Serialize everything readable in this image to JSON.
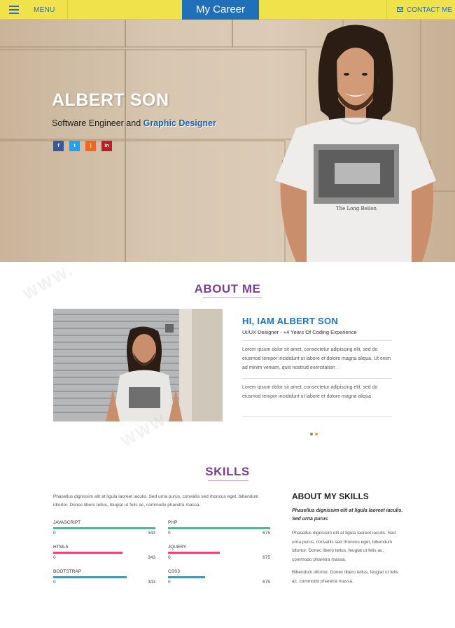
{
  "nav": {
    "menu_label": "MENU",
    "brand": "My Career",
    "contact_label": "CONTACT ME"
  },
  "hero": {
    "name": "ALBERT SON",
    "role_prefix": "Software Engineer and ",
    "role_highlight": "Graphic Designer",
    "tshirt_caption": "The Long Bellon",
    "socials": [
      {
        "icon": "facebook-icon",
        "glyph": "f",
        "color": "#3b5998"
      },
      {
        "icon": "twitter-icon",
        "glyph": "t",
        "color": "#1da1f2"
      },
      {
        "icon": "rss-icon",
        "glyph": ")",
        "color": "#f26522"
      },
      {
        "icon": "linkedin-icon",
        "glyph": "in",
        "color": "#c4172b"
      }
    ]
  },
  "about": {
    "title": "ABOUT ME",
    "heading": "HI, IAM ALBERT SON",
    "subtitle": "UI/UX Designer - +4 Years Of Coding Experience",
    "p1": "Lorem ipsum dolor sit amet, consectetur adipiscing elit, sed do eiusmod tempor incididunt ut labore et dolore magna aliqua. Ut enim ad minim veniam, quis nostrud exercitation .",
    "p2": "Lorem ipsum dolor sit amet, consectetur adipiscing elit, sed do eiusmod tempor incididunt ut labore et dolore magna aliqua.",
    "dot_colors": [
      "#888888",
      "#f0a030"
    ]
  },
  "skills": {
    "title": "SKILLS",
    "intro": "Phasellus dignissim elit at ligula laoreet iaculis. Sed urna purus, convallis sed rhoncus eget, bibendum idtortor. Donec libero tellus, feugiat ut felis ac, commodo pharetra massa.",
    "items": [
      {
        "name": "JAVASCRIPT",
        "min": "0",
        "max": "343",
        "level": 1.0,
        "color": "#2ec4a0"
      },
      {
        "name": "PHP",
        "min": "0",
        "max": "675",
        "level": 1.0,
        "color": "#2ec4a0"
      },
      {
        "name": "HTML5",
        "min": "0",
        "max": "343",
        "level": 0.68,
        "color": "#e8457a"
      },
      {
        "name": "JQUERY",
        "min": "0",
        "max": "675",
        "level": 0.51,
        "color": "#e8457a"
      },
      {
        "name": "BOOTSTRAP",
        "min": "0",
        "max": "343",
        "level": 0.72,
        "color": "#1aa5d8"
      },
      {
        "name": "CSS3",
        "min": "0",
        "max": "675",
        "level": 0.36,
        "color": "#1aa5d8"
      }
    ]
  },
  "about_skills": {
    "title": "ABOUT MY SKILLS",
    "lead": "Phasellus dignissim elit at ligula laoreet iaculis. Sed urna purus",
    "p1": "Phasellus dignissim elit at ligula laoreet iaculis. Sed urna purus, convallis sed rhoncus eget, bibendum idtortor. Donec libero tellus, feugiat ut felis ac, commodo pharetra massa.",
    "p2": "Bibendum idtortor. Donec libero tellus, feugiat ut felis ac, commodo pharetra massa."
  }
}
